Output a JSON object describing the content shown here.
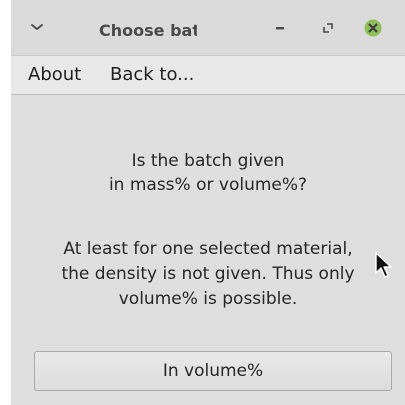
{
  "window": {
    "title": "Choose batch"
  },
  "menu": {
    "items": [
      {
        "label": "About"
      },
      {
        "label": "Back to..."
      }
    ]
  },
  "content": {
    "question_lines": [
      "Is the batch given",
      "in mass% or volume%?"
    ],
    "note_lines": [
      "At least for one selected material,",
      "the density is not given. Thus only",
      "volume% is possible."
    ],
    "button_label": "In volume%"
  },
  "icons": {
    "window_menu": "chevron-down-icon",
    "minimize": "minimize-icon",
    "maximize": "maximize-icon",
    "close": "close-icon",
    "cursor": "mouse-pointer-icon"
  },
  "colors": {
    "close_button": "#8fbf5a",
    "window_bg": "#dedede"
  }
}
